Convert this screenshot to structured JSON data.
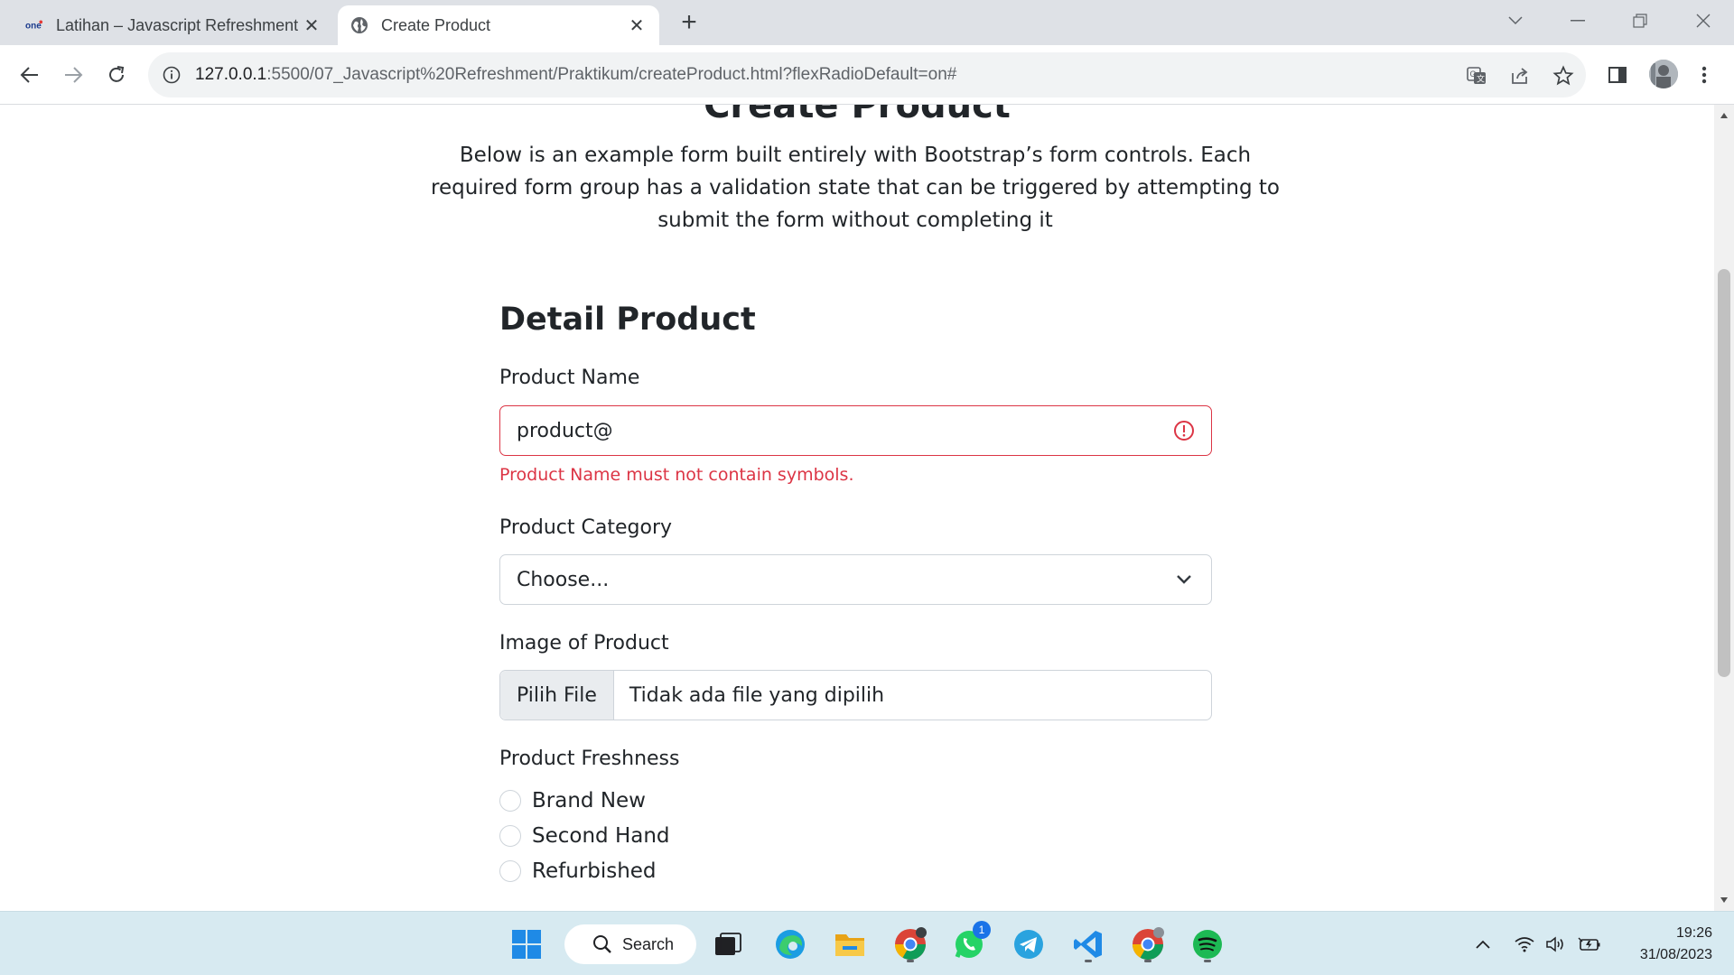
{
  "browser": {
    "tabs": [
      {
        "title": "Latihan – Javascript Refreshment",
        "favicon": "one-logo"
      },
      {
        "title": "Create Product",
        "favicon": "globe-icon"
      }
    ],
    "url_host": "127.0.0.1",
    "url_rest": ":5500/07_Javascript%20Refreshment/Praktikum/createProduct.html?flexRadioDefault=on#"
  },
  "page": {
    "heading": "Create Product",
    "lead": "Below is an example form built entirely with Bootstrap’s form controls. Each required form group has a validation state that can be triggered by attempting to submit the form without completing it",
    "section_title": "Detail Product",
    "product_name": {
      "label": "Product Name",
      "value": "product@",
      "error": "Product Name must not contain symbols."
    },
    "product_category": {
      "label": "Product Category",
      "selected": "Choose..."
    },
    "product_image": {
      "label": "Image of Product",
      "button": "Pilih File",
      "status": "Tidak ada file yang dipilih"
    },
    "product_freshness": {
      "label": "Product Freshness",
      "options": [
        "Brand New",
        "Second Hand",
        "Refurbished"
      ]
    }
  },
  "taskbar": {
    "search_label": "Search",
    "whatsapp_badge": "1",
    "time": "19:26",
    "date": "31/08/2023"
  },
  "colors": {
    "invalid": "#dc3545",
    "tabbar": "#dee1e6",
    "taskbar": "#d7eaf1"
  }
}
